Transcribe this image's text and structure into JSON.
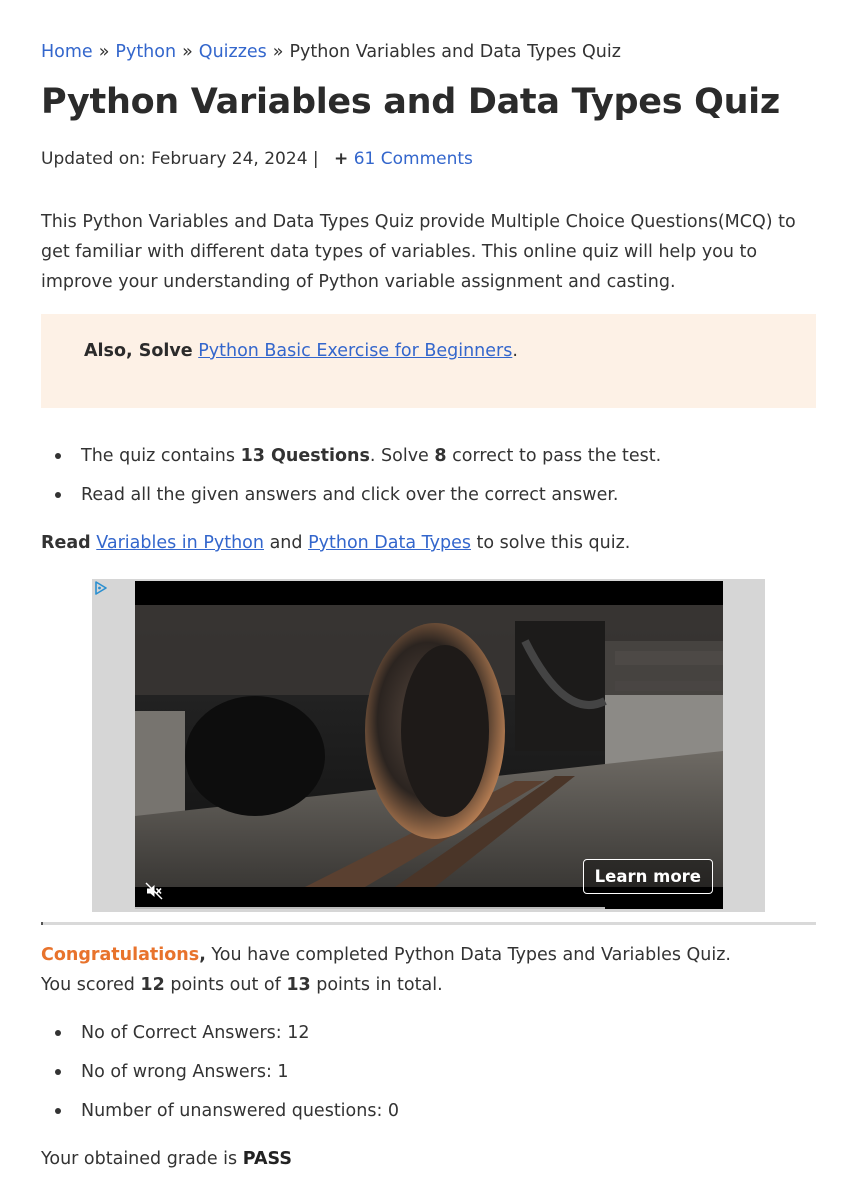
{
  "breadcrumb": {
    "home": "Home",
    "python": "Python",
    "quizzes": "Quizzes",
    "current": "Python Variables and Data Types Quiz",
    "separator": "»"
  },
  "page_title": "Python Variables and Data Types Quiz",
  "meta": {
    "updated_label": "Updated on: February 24, 2024 |",
    "comments_icon": "+",
    "comments_link": "61 Comments"
  },
  "intro": "This Python Variables and Data Types Quiz provide Multiple Choice Questions(MCQ) to get familiar with different data types of variables. This online quiz will help you to improve your understanding of Python variable assignment and casting.",
  "callout": {
    "prefix": "Also, Solve",
    "link": "Python Basic Exercise for Beginners",
    "suffix": "."
  },
  "quiz_info": {
    "item1_a": "The quiz contains ",
    "item1_b": "13 Questions",
    "item1_c": ". Solve ",
    "item1_d": "8",
    "item1_e": " correct to pass the test.",
    "item2": "Read all the given answers and click over the correct answer."
  },
  "read_line": {
    "read": "Read",
    "link1": "Variables in Python",
    "and": "and",
    "link2": "Python Data Types",
    "suffix": "to solve this quiz."
  },
  "ad": {
    "learn_more": "Learn more",
    "icons": [
      "adchoices-icon",
      "mute-icon"
    ],
    "video_progress": 0.8
  },
  "result": {
    "congrats": "Congratulations",
    "comma": ",",
    "completed": " You have completed Python Data Types and Variables Quiz.",
    "scored_a": "You scored ",
    "score": "12",
    "scored_b": " points out of ",
    "total": "13",
    "scored_c": " points in total."
  },
  "stats": {
    "correct": "No of Correct Answers: 12",
    "wrong": "No of wrong Answers: 1",
    "unanswered": "Number of unanswered questions: 0"
  },
  "grade": {
    "label": "Your obtained grade is ",
    "value": "PASS"
  },
  "colors": {
    "link": "#3366cc",
    "congrats": "#e8732c",
    "callout_bg": "#fdf1e6"
  }
}
